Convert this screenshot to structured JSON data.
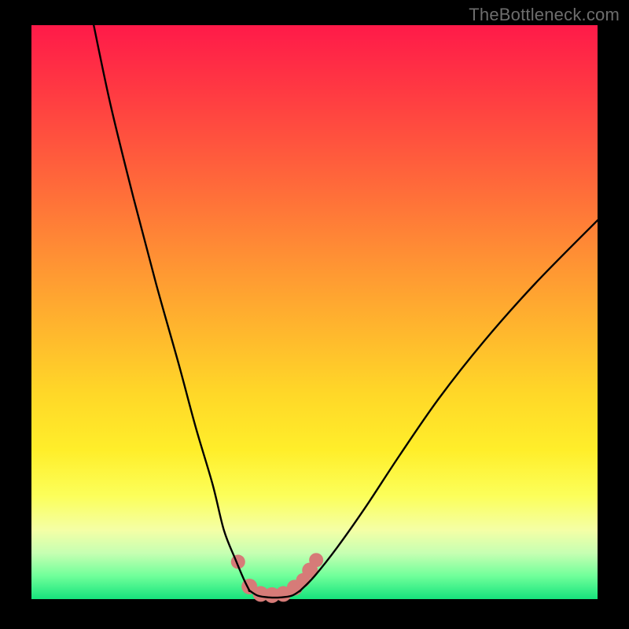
{
  "watermark": "TheBottleneck.com",
  "colors": {
    "background": "#000000",
    "curve_stroke": "#000000",
    "marker_fill": "#d67b78",
    "watermark_text": "#6d6d6d"
  },
  "chart_data": {
    "type": "line",
    "title": "",
    "xlabel": "",
    "ylabel": "",
    "xlim": [
      0,
      100
    ],
    "ylim": [
      0,
      100
    ],
    "grid": false,
    "legend": false,
    "series": [
      {
        "name": "left-branch",
        "x": [
          11,
          14,
          18,
          22,
          26,
          29,
          32,
          34,
          36,
          37.5,
          38.5
        ],
        "y": [
          100,
          86,
          70,
          55,
          41,
          30,
          20,
          12,
          7,
          3.5,
          1.5
        ]
      },
      {
        "name": "floor",
        "x": [
          38.5,
          40,
          42,
          44,
          46,
          47.5
        ],
        "y": [
          1.5,
          0.6,
          0.3,
          0.3,
          0.6,
          1.5
        ]
      },
      {
        "name": "right-branch",
        "x": [
          47.5,
          50,
          54,
          59,
          65,
          72,
          80,
          89,
          100
        ],
        "y": [
          1.5,
          4,
          9,
          16,
          25,
          35,
          45,
          55,
          66
        ]
      }
    ],
    "markers": {
      "name": "highlight-dots",
      "x": [
        36.5,
        38.5,
        40.5,
        42.5,
        44.5,
        46.5,
        48,
        49.2,
        50.3
      ],
      "y": [
        6.5,
        2.2,
        0.9,
        0.7,
        0.9,
        2.0,
        3.3,
        5.0,
        6.8
      ],
      "r": [
        9,
        10,
        10,
        10,
        10,
        10,
        9,
        10,
        9
      ]
    }
  }
}
